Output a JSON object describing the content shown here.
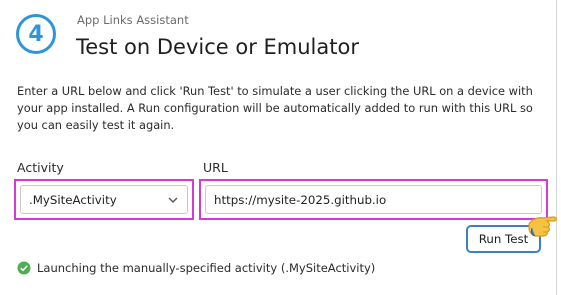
{
  "header": {
    "step_number": "4",
    "app_name": "App Links Assistant",
    "title": "Test on Device or Emulator"
  },
  "description": "Enter a URL below and click 'Run Test' to simulate a user clicking the URL on a device with your app installed. A Run configuration will be automatically added to run with this URL so you can easily test it again.",
  "activity": {
    "label": "Activity",
    "selected": ".MySiteActivity",
    "icon": "chevron-down-icon"
  },
  "url": {
    "label": "URL",
    "value": "https://mysite-2025.github.io"
  },
  "run_button": {
    "label": "Run Test"
  },
  "status": {
    "icon": "check-circle-icon",
    "text": "Launching the manually-specified activity (.MySiteActivity)"
  },
  "colors": {
    "accent": "#2f95d8",
    "highlight": "#d63ad6",
    "button_border": "#3f7ec0",
    "success": "#4caf50"
  }
}
